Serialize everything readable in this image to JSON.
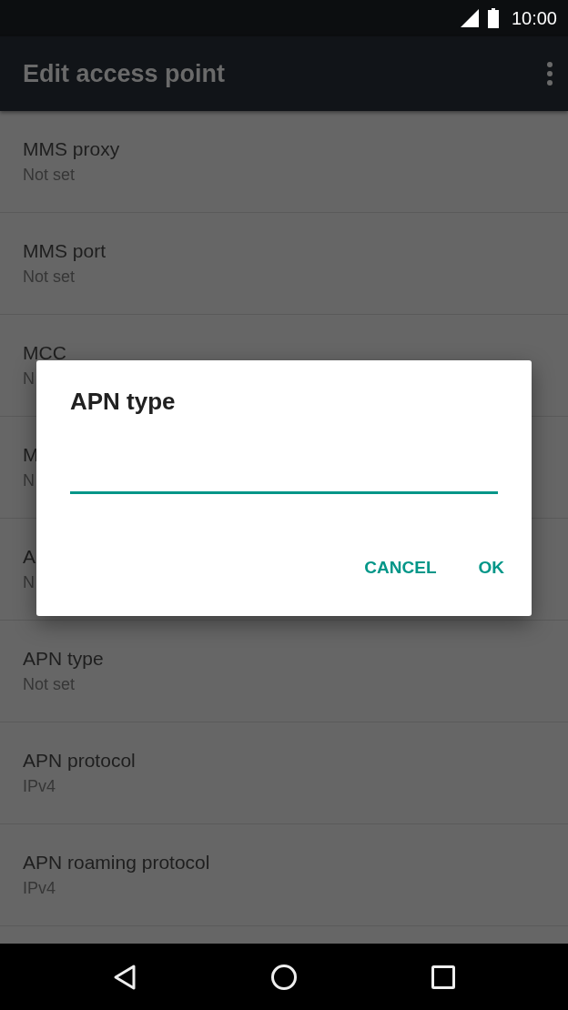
{
  "status_bar": {
    "time": "10:00"
  },
  "app_bar": {
    "title": "Edit access point"
  },
  "rows": [
    {
      "title": "MMS proxy",
      "summary": "Not set"
    },
    {
      "title": "MMS port",
      "summary": "Not set"
    },
    {
      "title": "MCC",
      "summary": "N"
    },
    {
      "title": "M",
      "summary": "N"
    },
    {
      "title": "A",
      "summary": "N"
    },
    {
      "title": "APN type",
      "summary": "Not set"
    },
    {
      "title": "APN protocol",
      "summary": "IPv4"
    },
    {
      "title": "APN roaming protocol",
      "summary": "IPv4"
    }
  ],
  "dialog": {
    "title": "APN type",
    "buttons": [
      "CANCEL",
      "OK"
    ]
  }
}
